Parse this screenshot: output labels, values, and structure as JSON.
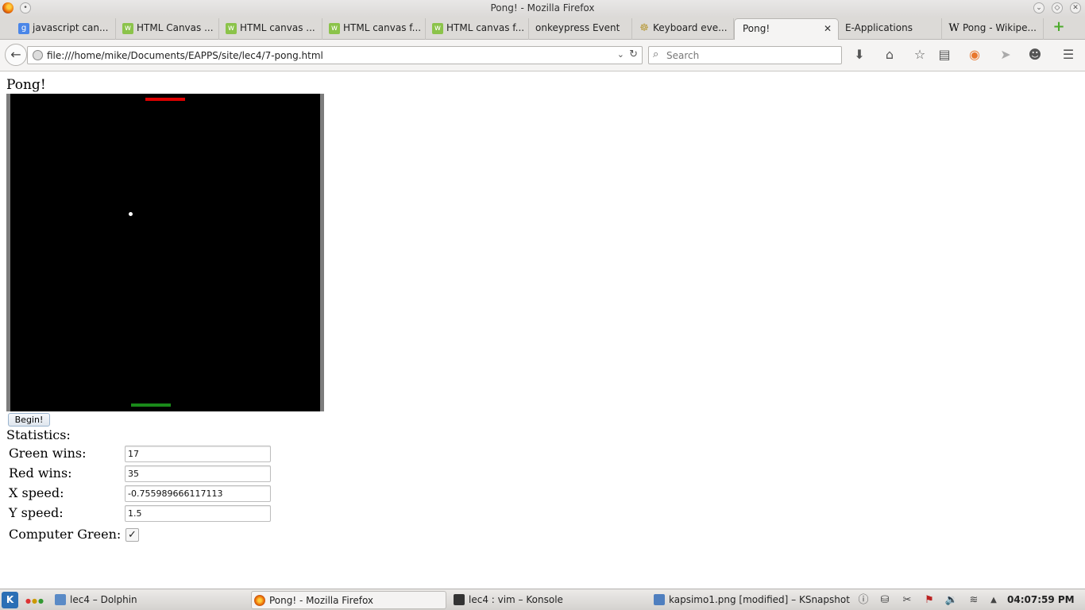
{
  "window": {
    "title": "Pong! - Mozilla Firefox"
  },
  "tabs": [
    {
      "label": "javascript can...",
      "favicon": "google-icon",
      "color": "#4a86e8"
    },
    {
      "label": "HTML Canvas ...",
      "favicon": "w3schools-icon",
      "color": "#8bc34a"
    },
    {
      "label": "HTML canvas ...",
      "favicon": "w3schools-icon",
      "color": "#8bc34a"
    },
    {
      "label": "HTML canvas f...",
      "favicon": "w3schools-icon",
      "color": "#8bc34a"
    },
    {
      "label": "HTML canvas f...",
      "favicon": "w3schools-icon",
      "color": "#8bc34a"
    },
    {
      "label": "onkeypress Event",
      "favicon": "",
      "color": ""
    },
    {
      "label": "Keyboard eve...",
      "favicon": "mdn-icon",
      "color": "#b89b3c"
    },
    {
      "label": "Pong!",
      "favicon": "",
      "color": "",
      "active": true
    },
    {
      "label": "E-Applications",
      "favicon": "",
      "color": ""
    },
    {
      "label": "Pong - Wikipe...",
      "favicon": "wikipedia-icon",
      "color": "#000000"
    }
  ],
  "nav": {
    "url": "file:///home/mike/Documents/EAPPS/site/lec4/7-pong.html",
    "search_placeholder": "Search"
  },
  "page": {
    "title": "Pong!",
    "begin_label": "Begin!",
    "statistics_label": "Statistics:",
    "stats": [
      {
        "label": "Green wins:",
        "value": "17"
      },
      {
        "label": "Red wins:",
        "value": "35"
      },
      {
        "label": "X speed:",
        "value": "-0.755989666117113"
      },
      {
        "label": "Y speed:",
        "value": "1.5"
      }
    ],
    "computer_green_label": "Computer Green:",
    "computer_green_checked": true
  },
  "game": {
    "background": "#000000",
    "red_paddle_color": "#e00000",
    "green_paddle_color": "#1a8a1a",
    "ball_color": "#ffffff"
  },
  "taskbar": {
    "tasks": [
      {
        "label": "lec4 – Dolphin"
      },
      {
        "label": "Pong! - Mozilla Firefox",
        "active": true
      },
      {
        "label": "lec4 : vim – Konsole"
      },
      {
        "label": "kapsimo1.png [modified] – KSnapshot"
      }
    ],
    "clock": "04:07:59 PM"
  }
}
